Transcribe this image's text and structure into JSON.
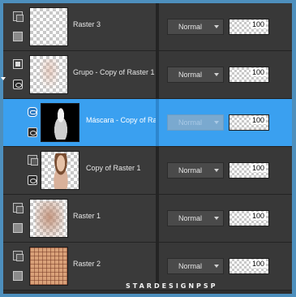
{
  "layers": [
    {
      "name": "Raster 3",
      "blend_mode": "Normal",
      "opacity": "100",
      "type": "raster",
      "thumbnail": "transparent"
    },
    {
      "name": "Grupo - Copy of Raster 1",
      "blend_mode": "Normal",
      "opacity": "100",
      "type": "group",
      "thumbnail": "faint-figure"
    },
    {
      "name": "Máscara - Copy of Ras",
      "blend_mode": "Normal",
      "opacity": "100",
      "type": "mask",
      "selected": true,
      "blend_disabled": true,
      "thumbnail": "mask"
    },
    {
      "name": "Copy of Raster 1",
      "blend_mode": "Normal",
      "opacity": "100",
      "type": "raster",
      "thumbnail": "figure"
    },
    {
      "name": "Raster 1",
      "blend_mode": "Normal",
      "opacity": "100",
      "type": "raster",
      "thumbnail": "blurred-figure"
    },
    {
      "name": "Raster 2",
      "blend_mode": "Normal",
      "opacity": "100",
      "type": "raster",
      "thumbnail": "plaid"
    }
  ],
  "watermark": "STARDESIGNPSP",
  "colors": {
    "selection": "#3aa0f0",
    "frame": "#4d8fbd",
    "panel": "#2f2f2f"
  },
  "icons": [
    "stack-icon",
    "visibility-box-icon",
    "group-icon",
    "eye-icon",
    "mask-icon",
    "expand-arrow-icon"
  ]
}
